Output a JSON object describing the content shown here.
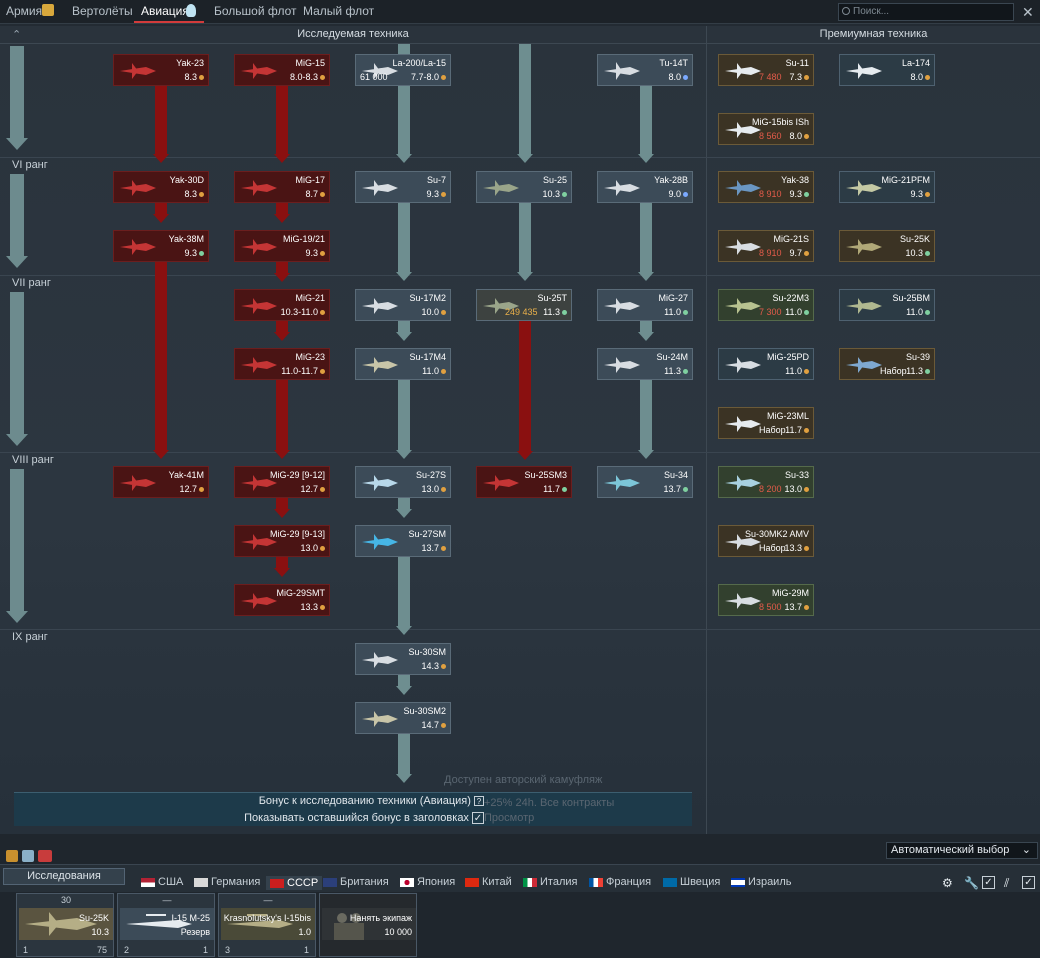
{
  "top_tabs": {
    "army": "Армия",
    "helicopters": "Вертолёты",
    "aviation": "Авиация",
    "large_fleet": "Большой флот",
    "small_fleet": "Малый флот"
  },
  "search": {
    "placeholder": "Поиск..."
  },
  "headers": {
    "researched": "Исследуемая техника",
    "premium": "Премиумная техника"
  },
  "ranks": {
    "r6": "VI ранг",
    "r7": "VII ранг",
    "r8": "VIII ранг",
    "r9": "IX ранг"
  },
  "cards": {
    "yak23": {
      "name": "Yak-23",
      "br": "8.3"
    },
    "mig15": {
      "name": "MiG-15",
      "br": "8.0-8.3"
    },
    "la200": {
      "name": "La-200/La-15",
      "cost": "61 000",
      "br": "7.7-8.0"
    },
    "tu14t": {
      "name": "Tu-14T",
      "br": "8.0"
    },
    "su11": {
      "name": "Su-11",
      "cost": "7 480",
      "br": "7.3"
    },
    "la174": {
      "name": "La-174",
      "br": "8.0"
    },
    "mig15bis": {
      "name": "MiG-15bis ISh",
      "cost": "8 560",
      "br": "8.0"
    },
    "yak30d": {
      "name": "Yak-30D",
      "br": "8.3"
    },
    "mig17": {
      "name": "MiG-17",
      "br": "8.7"
    },
    "su7": {
      "name": "Su-7",
      "br": "9.3"
    },
    "su25": {
      "name": "Su-25",
      "br": "10.3"
    },
    "yak28b": {
      "name": "Yak-28B",
      "br": "9.0"
    },
    "yak38": {
      "name": "Yak-38",
      "cost": "8 910",
      "br": "9.3"
    },
    "mig21pfm": {
      "name": "MiG-21PFM",
      "br": "9.3"
    },
    "yak38m": {
      "name": "Yak-38M",
      "br": "9.3"
    },
    "mig1921": {
      "name": "MiG-19/21",
      "br": "9.3"
    },
    "mig21s": {
      "name": "MiG-21S",
      "cost": "8 910",
      "br": "9.7"
    },
    "su25k": {
      "name": "Su-25K",
      "br": "10.3"
    },
    "mig21": {
      "name": "MiG-21",
      "br": "10.3-11.0"
    },
    "su17m2": {
      "name": "Su-17M2",
      "br": "10.0"
    },
    "su25t": {
      "name": "Su-25T",
      "cost": "249 435",
      "br": "11.3"
    },
    "mig27": {
      "name": "MiG-27",
      "br": "11.0"
    },
    "su22m3": {
      "name": "Su-22M3",
      "cost": "7 300",
      "br": "11.0"
    },
    "su25bm": {
      "name": "Su-25BM",
      "br": "11.0"
    },
    "mig23": {
      "name": "MiG-23",
      "br": "11.0-11.7"
    },
    "su17m4": {
      "name": "Su-17M4",
      "br": "11.0"
    },
    "su24m": {
      "name": "Su-24M",
      "br": "11.3"
    },
    "mig25pd": {
      "name": "MiG-25PD",
      "br": "11.0"
    },
    "su39": {
      "name": "Su-39",
      "cost": "Набор",
      "br": "11.3"
    },
    "mig23ml": {
      "name": "MiG-23ML",
      "cost": "Набор",
      "br": "11.7"
    },
    "yak41m": {
      "name": "Yak-41M",
      "br": "12.7"
    },
    "mig29_912": {
      "name": "MiG-29 [9-12]",
      "br": "12.7"
    },
    "su27s": {
      "name": "Su-27S",
      "br": "13.0"
    },
    "su25sm3": {
      "name": "Su-25SM3",
      "br": "11.7"
    },
    "su34": {
      "name": "Su-34",
      "br": "13.7"
    },
    "su33": {
      "name": "Su-33",
      "cost": "8 200",
      "br": "13.0"
    },
    "mig29_913": {
      "name": "MiG-29 [9-13]",
      "br": "13.0"
    },
    "su27sm": {
      "name": "Su-27SM",
      "br": "13.7"
    },
    "su30mk2": {
      "name": "Su-30MK2 AMV",
      "cost": "Набор",
      "br": "13.3"
    },
    "mig29smt": {
      "name": "MiG-29SMT",
      "br": "13.3"
    },
    "mig29m": {
      "name": "MiG-29M",
      "cost": "8 500",
      "br": "13.7"
    },
    "su30sm": {
      "name": "Su-30SM",
      "br": "14.3"
    },
    "su30sm2": {
      "name": "Su-30SM2",
      "br": "14.7"
    }
  },
  "bonus": {
    "line1": "Бонус к исследованию техники (Авиация)",
    "line2": "Показывать оставшийся бонус в заголовках",
    "ghost1": "Доступен авторский камуфляж",
    "ghost2": "+25% 24h. Все контракты",
    "ghost3": "Просмотр"
  },
  "bottom": {
    "researching": "Исследования",
    "auto_select": "Автоматический выбор",
    "nations": [
      "США",
      "Германия",
      "СССР",
      "Британия",
      "Япония",
      "Китай",
      "Италия",
      "Франция",
      "Швеция",
      "Израиль"
    ],
    "active_nation": "СССР"
  },
  "crews": [
    {
      "top": "30",
      "name": "Su-25K",
      "br": "10.3",
      "num": "1",
      "right": "75"
    },
    {
      "top": "—",
      "name": "I-15 M-25",
      "br": "Резерв",
      "num": "2",
      "right": "1"
    },
    {
      "top": "—",
      "name": "Krasnolutsky's I-15bis",
      "br": "1.0",
      "num": "3",
      "right": "1"
    },
    {
      "top": "",
      "name": "Нанять экипаж",
      "br": "10 000",
      "num": "",
      "right": ""
    }
  ],
  "colors": {
    "locked": "#4a1414",
    "researched": "#3c4b58",
    "premium": "#3b3324",
    "accent": "#d23b3b",
    "arrow": "#6e8e90"
  }
}
